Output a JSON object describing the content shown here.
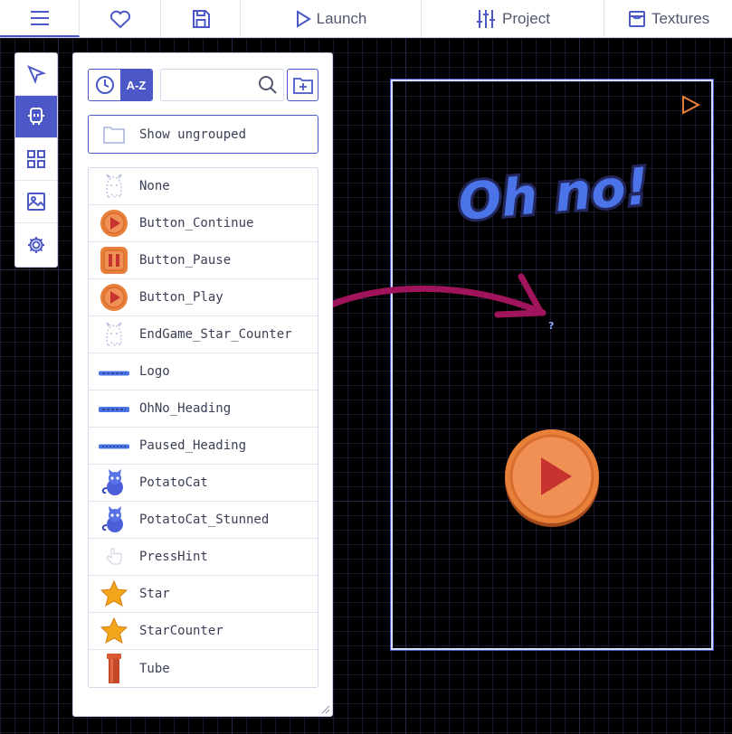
{
  "topbar": {
    "tabs": [
      {
        "id": "menu",
        "icon": "hamburger-icon",
        "label": ""
      },
      {
        "id": "favorite",
        "icon": "heart-icon",
        "label": ""
      },
      {
        "id": "save",
        "icon": "floppy-disk-icon",
        "label": ""
      },
      {
        "id": "launch",
        "icon": "play-triangle-icon",
        "label": "Launch"
      },
      {
        "id": "project",
        "icon": "sliders-icon",
        "label": "Project"
      },
      {
        "id": "textures",
        "icon": "texture-icon",
        "label": "Textures"
      }
    ]
  },
  "toolbar": {
    "tools": [
      {
        "name": "select-tool",
        "icon": "cursor-arrow-icon",
        "active": false
      },
      {
        "name": "templates-tool",
        "icon": "robot-icon",
        "active": true
      },
      {
        "name": "tiles-tool",
        "icon": "grid-icon",
        "active": false
      },
      {
        "name": "backgrounds-tool",
        "icon": "image-icon",
        "active": false
      },
      {
        "name": "settings-tool",
        "icon": "gear-icon",
        "active": false
      }
    ]
  },
  "panel": {
    "sort_az_label": "A-Z",
    "search_value": "",
    "show_ungrouped_label": "Show ungrouped",
    "templates": [
      {
        "name": "None",
        "thumb": "ghost"
      },
      {
        "name": "Button_Continue",
        "thumb": "play-button"
      },
      {
        "name": "Button_Pause",
        "thumb": "pause-button"
      },
      {
        "name": "Button_Play",
        "thumb": "play-button"
      },
      {
        "name": "EndGame_Star_Counter",
        "thumb": "ghost"
      },
      {
        "name": "Logo",
        "thumb": "logo-text"
      },
      {
        "name": "OhNo_Heading",
        "thumb": "ohno-text"
      },
      {
        "name": "Paused_Heading",
        "thumb": "paused-text"
      },
      {
        "name": "PotatoCat",
        "thumb": "cat"
      },
      {
        "name": "PotatoCat_Stunned",
        "thumb": "cat"
      },
      {
        "name": "PressHint",
        "thumb": "hand"
      },
      {
        "name": "Star",
        "thumb": "star"
      },
      {
        "name": "StarCounter",
        "thumb": "star"
      },
      {
        "name": "Tube",
        "thumb": "tube"
      }
    ]
  },
  "scene": {
    "heading_text": "Oh no!",
    "cursor_mark": "?",
    "colors": {
      "accent": "#4c58c8",
      "arrow": "#a0145c",
      "button": "#e8803a",
      "heading": "#4a74e8"
    }
  }
}
